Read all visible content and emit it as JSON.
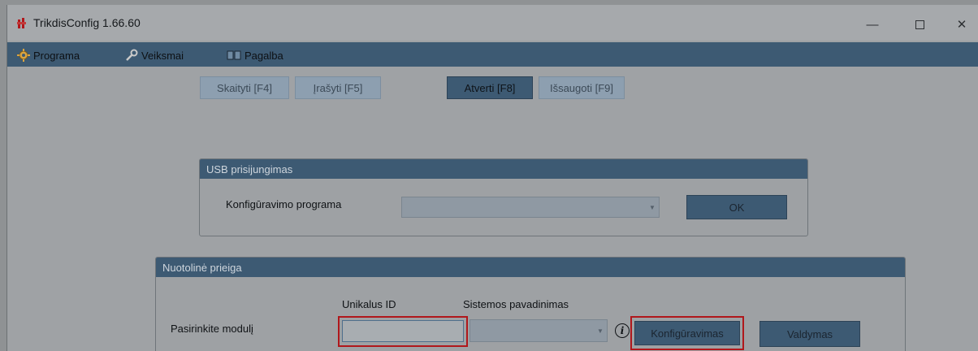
{
  "window": {
    "title": "TrikdisConfig 1.66.60"
  },
  "menu": {
    "items": [
      {
        "label": "Programa",
        "icon": "gear-icon"
      },
      {
        "label": "Veiksmai",
        "icon": "wrench-icon"
      },
      {
        "label": "Pagalba",
        "icon": "book-icon"
      }
    ]
  },
  "toolbar": {
    "read": "Skaityti [F4]",
    "write": "Įrašyti [F5]",
    "open": "Atverti [F8]",
    "save": "Išsaugoti [F9]"
  },
  "usb": {
    "header": "USB prisijungimas",
    "label": "Konfigūravimo programa",
    "selected": "",
    "ok": "OK"
  },
  "remote": {
    "header": "Nuotolinė prieiga",
    "col_id": "Unikalus ID",
    "col_name": "Sistemos pavadinimas",
    "label": "Pasirinkite modulį",
    "id_value": "",
    "name_value": "",
    "configure": "Konfigūravimas",
    "control": "Valdymas",
    "info_glyph": "i"
  },
  "colors": {
    "accent": "#3d5a73",
    "highlight": "#b0171b"
  }
}
